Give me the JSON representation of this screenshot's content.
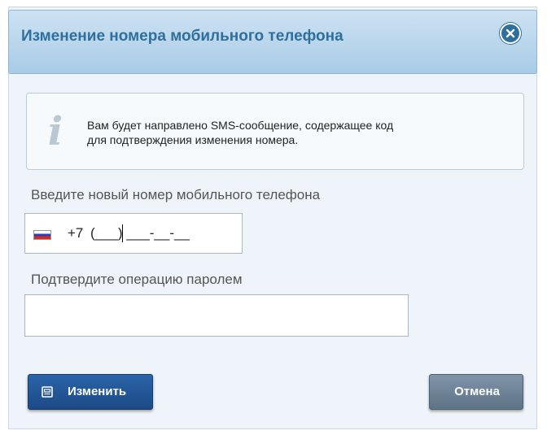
{
  "dialog": {
    "title": "Изменение номера мобильного телефона",
    "close_icon": "close-circle-icon"
  },
  "info": {
    "icon": "info-icon",
    "icon_glyph": "i",
    "text_line1": "Вам будет направлено SMS-сообщение, содержащее код",
    "text_line2": "для подтверждения изменения номера."
  },
  "phone": {
    "label": "Введите новый номер мобильного телефона",
    "flag_icon": "russia-flag-icon",
    "prefix": "+7",
    "mask": "(___) ___-__-__",
    "value": ""
  },
  "password": {
    "label": "Подтвердите операцию паролем",
    "value": ""
  },
  "actions": {
    "submit_label": "Изменить",
    "submit_icon": "save-icon",
    "cancel_label": "Отмена"
  },
  "colors": {
    "accent": "#2f6f9e",
    "primary_button": "#1c4a86",
    "secondary_button": "#6b8094"
  }
}
